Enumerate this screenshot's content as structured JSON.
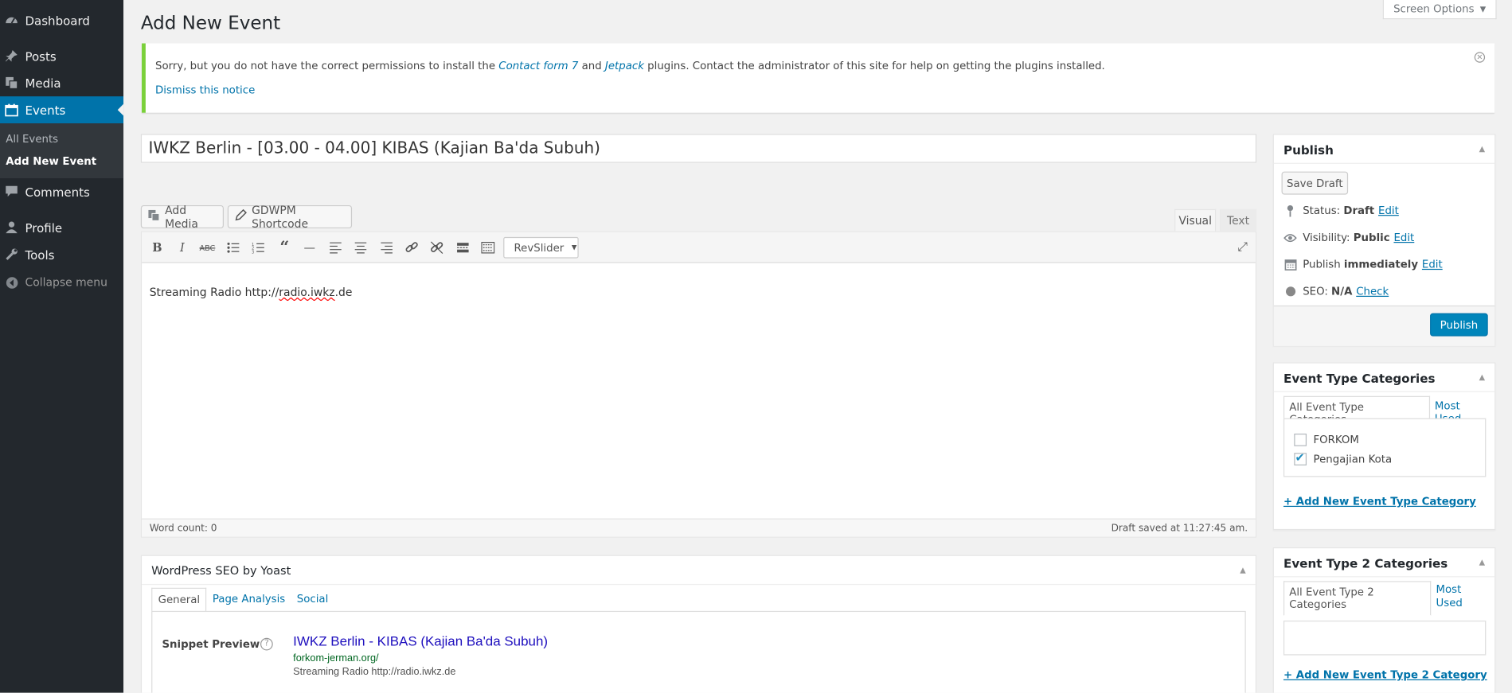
{
  "sidebar": {
    "items": [
      {
        "label": "Dashboard",
        "icon": "dashboard-icon"
      },
      {
        "label": "Posts",
        "icon": "pushpin-icon"
      },
      {
        "label": "Media",
        "icon": "media-icon"
      },
      {
        "label": "Events",
        "icon": "calendar-icon"
      },
      {
        "label": "Comments",
        "icon": "comment-icon"
      },
      {
        "label": "Profile",
        "icon": "user-icon"
      },
      {
        "label": "Tools",
        "icon": "wrench-icon"
      }
    ],
    "submenu": [
      "All Events",
      "Add New Event"
    ],
    "collapse": "Collapse menu"
  },
  "page": {
    "title": "Add New Event",
    "screen_options": "Screen Options"
  },
  "notice": {
    "text_before": "Sorry, but you do not have the correct permissions to install the ",
    "link1": "Contact form 7",
    "text_mid": " and ",
    "link2": "Jetpack",
    "text_after": " plugins. Contact the administrator of this site for help on getting the plugins installed.",
    "dismiss": "Dismiss this notice"
  },
  "post": {
    "title": "IWKZ Berlin - [03.00 - 04.00] KIBAS (Kajian Ba'da Subuh)"
  },
  "media_buttons": {
    "add_media": "Add Media",
    "gdwpm": "GDWPM Shortcode"
  },
  "editor": {
    "tabs": [
      "Visual",
      "Text"
    ],
    "revslider": "RevSlider",
    "content_prefix": "Streaming Radio http://",
    "content_link": "radio.iwkz",
    "content_suffix": ".de",
    "word_count": "Word count: 0",
    "draft_saved": "Draft saved at 11:27:45 am."
  },
  "publish": {
    "title": "Publish",
    "save_draft": "Save Draft",
    "status_label": "Status:",
    "status_value": "Draft",
    "status_edit": "Edit",
    "visibility_label": "Visibility:",
    "visibility_value": "Public",
    "visibility_edit": "Edit",
    "publish_label": "Publish",
    "publish_value": "immediately",
    "publish_edit": "Edit",
    "seo_label": "SEO:",
    "seo_value": "N/A",
    "seo_check": "Check",
    "publish_button": "Publish"
  },
  "event_type": {
    "title": "Event Type Categories",
    "tabs": [
      "All Event Type Categories",
      "Most Used"
    ],
    "items": [
      {
        "label": "FORKOM",
        "checked": false
      },
      {
        "label": "Pengajian Kota",
        "checked": true
      }
    ],
    "add_new": "+ Add New Event Type Category"
  },
  "event_type2": {
    "title": "Event Type 2 Categories",
    "tabs": [
      "All Event Type 2 Categories",
      "Most Used"
    ],
    "add_new": "+ Add New Event Type 2 Category"
  },
  "seo": {
    "title": "WordPress SEO by Yoast",
    "tabs": [
      "General",
      "Page Analysis",
      "Social"
    ],
    "snippet_label": "Snippet Preview",
    "help": "?",
    "snippet_title": "IWKZ Berlin - KIBAS (Kajian Ba'da Subuh)",
    "snippet_url": "forkom-jerman.org/",
    "snippet_desc": "Streaming Radio http://radio.iwkz.de"
  },
  "colors": {
    "accent": "#0073aa",
    "sidebar": "#23282d",
    "publish_button": "#0085ba",
    "notice_border": "#7ad03a",
    "snippet_title": "#1e0fbe",
    "snippet_url": "#006621"
  }
}
